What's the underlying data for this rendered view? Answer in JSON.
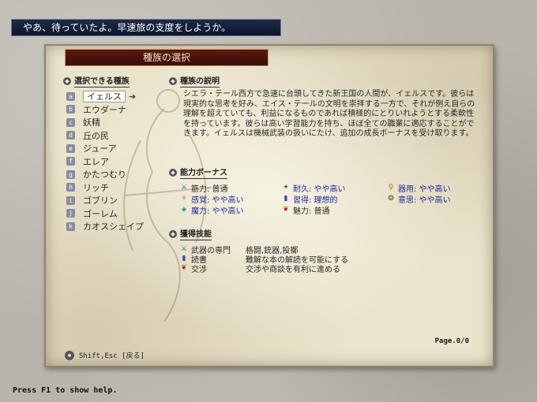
{
  "message": "やあ、待っていたよ。早速旅の支度をしようか。",
  "panel": {
    "title": "種族の選択",
    "list_heading": "選択できる種族",
    "desc_heading": "種族の説明",
    "bonus_heading": "能力ボーナス",
    "skills_heading": "獲得技能",
    "page": "Page.0/0",
    "hint": "Shift,Esc [戻る]"
  },
  "races": [
    {
      "key": "a",
      "name": "イェルス",
      "selected": true
    },
    {
      "key": "b",
      "name": "エウダーナ"
    },
    {
      "key": "c",
      "name": "妖精"
    },
    {
      "key": "d",
      "name": "丘の民"
    },
    {
      "key": "e",
      "name": "ジューア"
    },
    {
      "key": "f",
      "name": "エレア"
    },
    {
      "key": "g",
      "name": "かたつむり"
    },
    {
      "key": "h",
      "name": "リッチ"
    },
    {
      "key": "i",
      "name": "ゴブリン"
    },
    {
      "key": "j",
      "name": "ゴーレム"
    },
    {
      "key": "k",
      "name": "カオスシェイプ"
    }
  ],
  "description": "シエラ・テール西方で急速に台頭してきた新王国の人間が、イェルスです。彼らは現実的な思考を好み、エイス・テールの文明を崇拝する一方で、それが例え自らの理解を超えていても、利益になるものであれば積極的にとりいれようとする柔軟性を持っています。彼らは高い学習能力を持ち、ほぼ全ての職業に適応することができます。イェルスは機械武装の扱いにたけ、追加の成長ボーナスを受け取ります。",
  "bonuses": [
    {
      "icon": "sword-icon",
      "glyph": "⚔",
      "color": "#3a5fa8",
      "text": "筋力: 普通",
      "highlight": false
    },
    {
      "icon": "armor-icon",
      "glyph": "✦",
      "color": "#555555",
      "text": "耐久: やや高い",
      "highlight": true
    },
    {
      "icon": "gear-icon",
      "glyph": "♀",
      "color": "#a86a20",
      "text": "器用: やや高い",
      "highlight": true
    },
    {
      "icon": "eye-icon",
      "glyph": "✧",
      "color": "#8a3a6a",
      "text": "感覚: やや高い",
      "highlight": true
    },
    {
      "icon": "book-icon",
      "glyph": "▮",
      "color": "#3a4ab0",
      "text": "習得: 理想的",
      "highlight": true
    },
    {
      "icon": "will-icon",
      "glyph": "❂",
      "color": "#8a4a10",
      "text": "意思: やや高い",
      "highlight": true
    },
    {
      "icon": "magic-icon",
      "glyph": "◈",
      "color": "#2a8a9a",
      "text": "魔力: やや高い",
      "highlight": true
    },
    {
      "icon": "charm-icon",
      "glyph": "❦",
      "color": "#b02020",
      "text": "魅力: 普通",
      "highlight": false
    }
  ],
  "skills": [
    {
      "icon": "weapon-icon",
      "glyph": "⚔",
      "color": "#3a5fa8",
      "name": "武器の専門",
      "desc": "格闘,銃器,投擲"
    },
    {
      "icon": "book-icon",
      "glyph": "▮",
      "color": "#3a4ab0",
      "name": "読書",
      "desc": "難解な本の解読を可能にする"
    },
    {
      "icon": "negotiation-icon",
      "glyph": "❦",
      "color": "#b02020",
      "name": "交渉",
      "desc": "交渉や商談を有利に進める"
    }
  ],
  "help_text": "Press F1 to show help."
}
